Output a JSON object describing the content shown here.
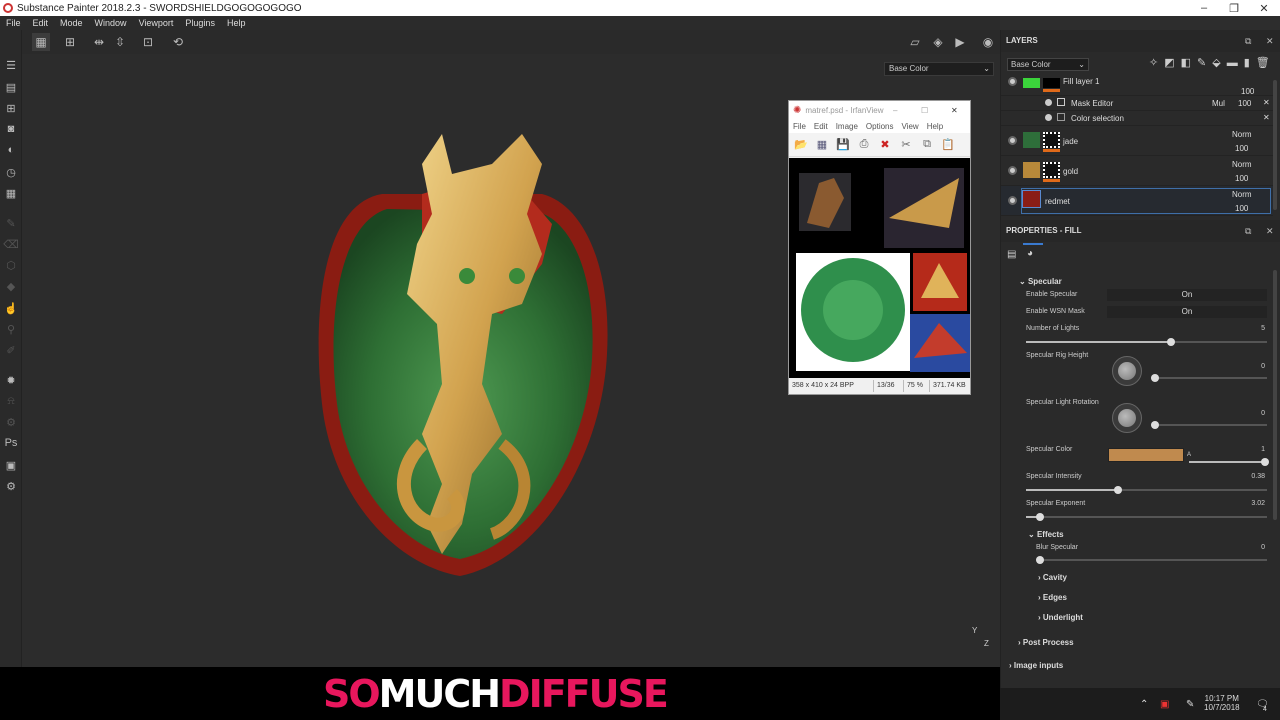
{
  "app": {
    "title": "Substance Painter 2018.2.3 - SWORDSHIELDGOGOGOGOGO"
  },
  "menu": [
    "File",
    "Edit",
    "Mode",
    "Window",
    "Viewport",
    "Plugins",
    "Help"
  ],
  "viewport": {
    "channel_dropdown": "Base Color",
    "axis_y": "Y",
    "axis_z": "Z"
  },
  "banner": {
    "part1": "SO",
    "part2": "MUCH",
    "part3": "DIFFUSE"
  },
  "irfanview": {
    "title": "matref.psd - IrfanView",
    "menu": [
      "File",
      "Edit",
      "Image",
      "Options",
      "View",
      "Help"
    ],
    "status": [
      "358 x 410 x 24 BPP",
      "13/36",
      "75 %",
      "371.74 KB"
    ]
  },
  "layers": {
    "title": "LAYERS",
    "channel": "Base Color",
    "items": [
      {
        "name": "Fill layer 1",
        "blend": "",
        "opacity": "100"
      },
      {
        "name": "Mask Editor",
        "blend": "Mul",
        "opacity": "100"
      },
      {
        "name": "Color selection",
        "blend": "",
        "opacity": ""
      },
      {
        "name": "jade",
        "blend": "Norm",
        "opacity": "100"
      },
      {
        "name": "gold",
        "blend": "Norm",
        "opacity": "100"
      },
      {
        "name": "redmet",
        "blend": "Norm",
        "opacity": "100"
      }
    ]
  },
  "properties": {
    "title": "PROPERTIES - FILL",
    "specular_section": "Specular",
    "enable_specular": {
      "label": "Enable Specular",
      "value": "On"
    },
    "enable_wsn": {
      "label": "Enable WSN Mask",
      "value": "On"
    },
    "num_lights": {
      "label": "Number of Lights",
      "value": "5",
      "fraction": 0.6
    },
    "rig_height": {
      "label": "Specular Rig Height",
      "value": "0",
      "fraction": 0.0
    },
    "light_rotation": {
      "label": "Specular Light Rotation",
      "value": "0",
      "fraction": 0.0
    },
    "spec_color": {
      "label": "Specular Color",
      "value": "1",
      "alpha_label": "A",
      "color": "#c08a4e"
    },
    "spec_intensity": {
      "label": "Specular Intensity",
      "value": "0.38",
      "fraction": 0.38
    },
    "spec_exponent": {
      "label": "Specular Exponent",
      "value": "3.02",
      "fraction": 0.06
    },
    "effects_section": "Effects",
    "blur_specular": {
      "label": "Blur Specular",
      "value": "0",
      "fraction": 0.0
    },
    "cavity": "Cavity",
    "edges": "Edges",
    "underlight": "Underlight",
    "post_process": "Post Process",
    "image_inputs": "Image inputs"
  },
  "taskbar": {
    "time": "10:17 PM",
    "date": "10/7/2018",
    "notifications": "4"
  }
}
